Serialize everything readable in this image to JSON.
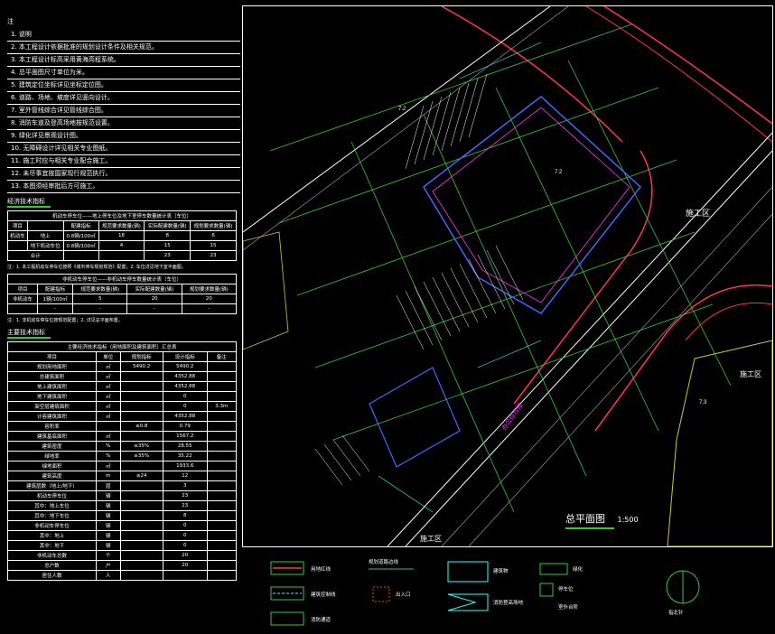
{
  "notes": {
    "header": "注",
    "items": [
      "1. 说明",
      "2. 本工程设计依据批准的规划设计条件及相关规范。",
      "3. 本工程设计标高采用黄海高程系统。",
      "4. 总平面图尺寸单位为米。",
      "5. 建筑定位坐标详见坐标定位图。",
      "6. 道路、场地、坡度详见竖向设计。",
      "7. 室外管线综合详见管线综合图。",
      "8. 消防车道及登高场地按规范设置。",
      "9. 绿化详见景观设计图。",
      "10. 无障碍设计详见相关专业图纸。",
      "11. 施工时应与相关专业配合施工。",
      "12. 未尽事宜按国家现行规范执行。",
      "13. 本图须经审批后方可施工。"
    ]
  },
  "section1": {
    "title": "经济技术指标"
  },
  "table1": {
    "caption": "机动车停车位——地上停车位及地下室停车数量统计表（车位）",
    "header": [
      "项目",
      "",
      "配建指标",
      "规范要求数量(辆)",
      "实际配建数量(辆)",
      "规划要求数量(辆)"
    ],
    "rows": [
      [
        "机动车",
        "地上",
        "0.8辆/100㎡",
        "18",
        "8",
        "6"
      ],
      [
        "",
        "地下机动车位",
        "0.8辆/100㎡",
        "4",
        "15",
        "15"
      ]
    ],
    "total": [
      "合计",
      "",
      "",
      "23",
      "23"
    ],
    "note": "注：1. 本工程机动车停车位按照《城市停车规划规范》配置；2. 车位详见地下室平面图。"
  },
  "table2": {
    "caption": "非机动车停车位——非机动车停车数量统计表（车位）",
    "header": [
      "项目",
      "配建指标",
      "规范要求数量(辆)",
      "实际配建数量(辆)",
      "规划要求数量(辆)"
    ],
    "rows": [
      [
        "非机动车",
        "1辆/100㎡",
        "5",
        "20",
        "20"
      ],
      [
        "",
        "-",
        "-",
        "-",
        "-"
      ]
    ],
    "note": "注：1. 非机动车停车位按规范配置；2. 详见总平面布置。"
  },
  "section2": {
    "title": "主要技术指标"
  },
  "table3": {
    "caption": "主要经济技术指标（用地面积及建筑面积）汇总表",
    "header": [
      "项目",
      "单位",
      "规划指标",
      "设计指标",
      "备注"
    ],
    "rows": [
      [
        "规划用地面积",
        "㎡",
        "5490.2",
        "5490.2",
        ""
      ],
      [
        "总建筑面积",
        "㎡",
        "",
        "4352.88",
        ""
      ],
      [
        "地上建筑面积",
        "㎡",
        "",
        "4352.88",
        ""
      ],
      [
        "地下建筑面积",
        "㎡",
        "",
        "0",
        ""
      ],
      [
        "架空层建筑面积",
        "㎡",
        "",
        "0",
        "3.3m"
      ],
      [
        "计容建筑面积",
        "㎡",
        "",
        "4352.88",
        ""
      ],
      [
        "容积率",
        "",
        "≤0.8",
        "0.79",
        ""
      ],
      [
        "建筑基底面积",
        "㎡",
        "",
        "1567.2",
        ""
      ],
      [
        "建筑密度",
        "%",
        "≤35%",
        "28.55",
        ""
      ],
      [
        "绿地率",
        "%",
        "≥35%",
        "35.22",
        ""
      ],
      [
        "绿地面积",
        "㎡",
        "",
        "1933.6",
        ""
      ],
      [
        "建筑高度",
        "m",
        "≤24",
        "12",
        ""
      ],
      [
        "建筑层数（地上/地下）",
        "层",
        "",
        "3",
        ""
      ],
      [
        "机动车停车位",
        "辆",
        "",
        "23",
        ""
      ],
      [
        "其中：地上车位",
        "辆",
        "",
        "23",
        ""
      ],
      [
        "其中：地下车位",
        "辆",
        "",
        "8",
        ""
      ],
      [
        "非机动车停车位",
        "辆",
        "",
        "0",
        ""
      ],
      [
        "其中：地上",
        "辆",
        "",
        "0",
        ""
      ],
      [
        "其中：地下",
        "辆",
        "",
        "0",
        ""
      ],
      [
        "非机动车总数",
        "个",
        "",
        "20",
        ""
      ],
      [
        "总户数",
        "户",
        "",
        "20",
        ""
      ],
      [
        "居住人数",
        "人",
        "",
        "",
        ""
      ]
    ]
  },
  "drawing": {
    "title": "总平面图",
    "scale": "1:500",
    "construction_zone_labels": [
      "施工区",
      "施工区",
      "施工区"
    ],
    "building_label": "办公综合楼",
    "level_labels": [
      "7.2",
      "7.2",
      "7.3"
    ]
  },
  "legend": {
    "items": [
      "用地红线",
      "建筑控制线",
      "消防通道",
      "规划道路边线",
      "出入口",
      "建筑物",
      "消防登高场地",
      "绿化",
      "停车位",
      "室外台阶",
      "指北针"
    ]
  },
  "colors": {
    "background": "#000000",
    "line_white": "#ffffff",
    "green": "#33cc33",
    "red": "#ff3355",
    "magenta": "#ff33ff",
    "cyan": "#33ffff",
    "blue": "#4466ff",
    "yellow": "#cccc33"
  }
}
